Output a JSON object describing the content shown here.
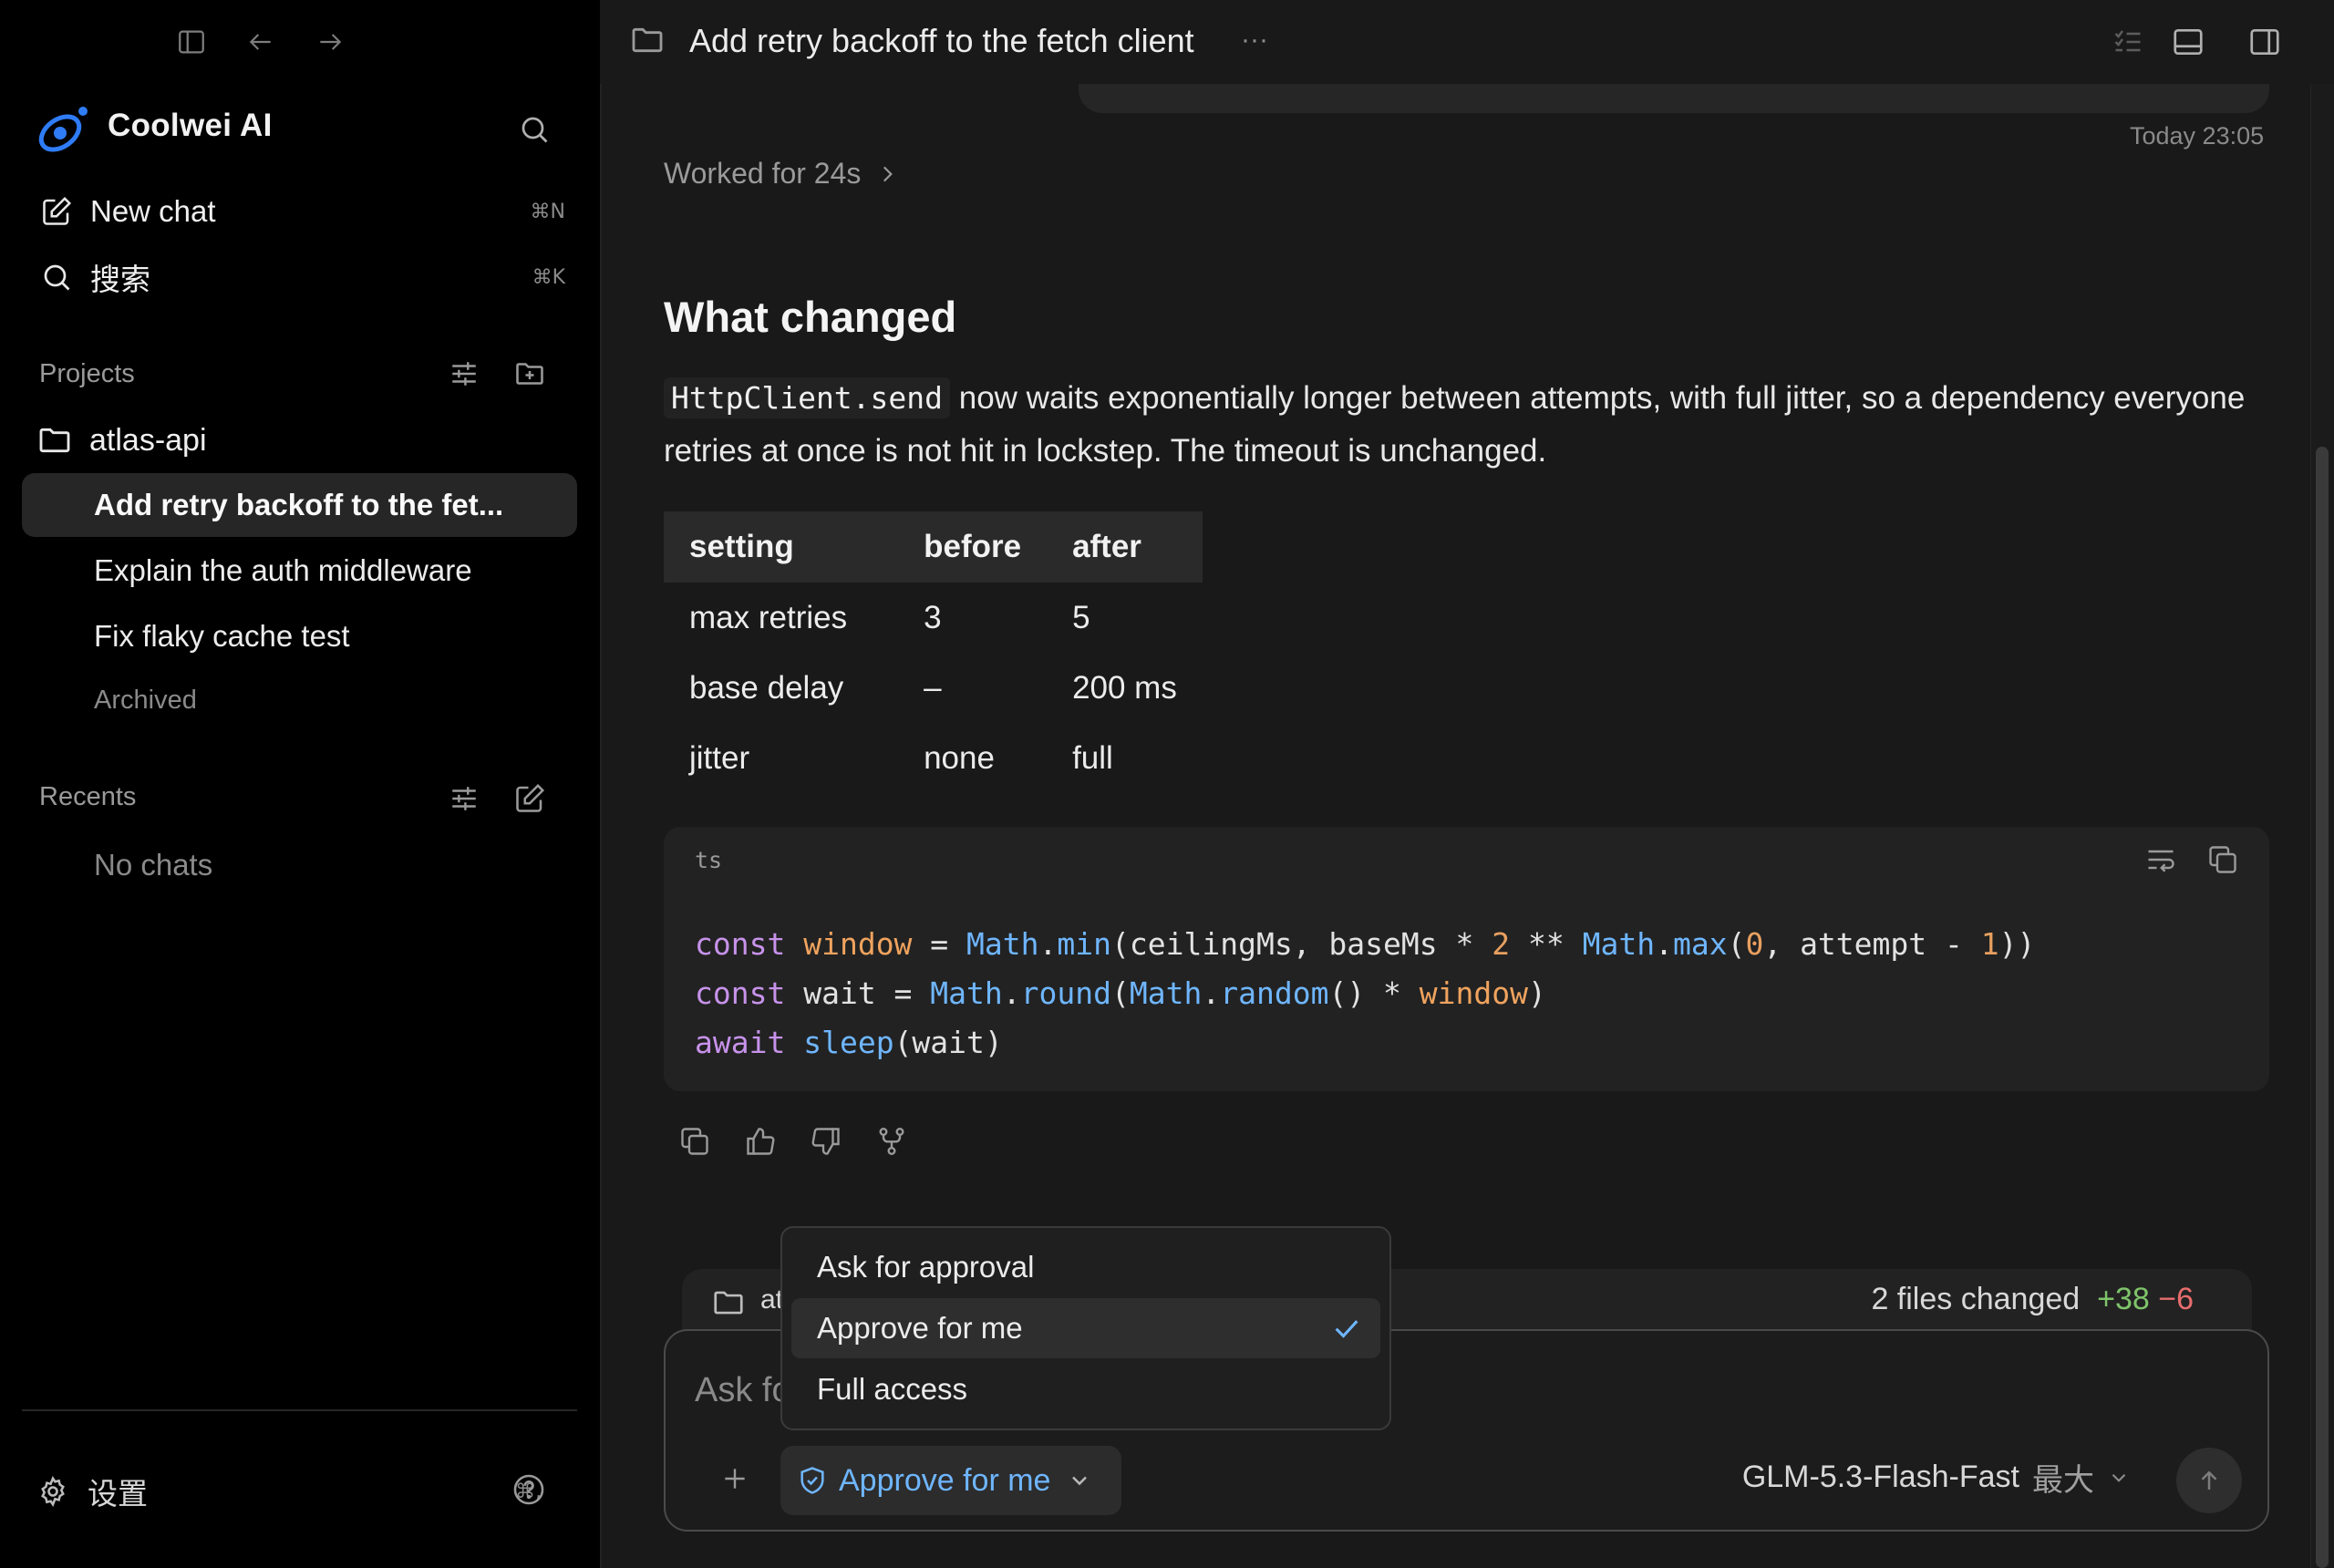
{
  "sidebar": {
    "brand_name": "Coolwei AI",
    "nav": {
      "new_chat": {
        "label": "New chat",
        "shortcut": "⌘N"
      },
      "search": {
        "label": "搜索",
        "shortcut": "⌘K"
      }
    },
    "projects": {
      "title": "Projects",
      "project_name": "atlas-api",
      "chats": [
        {
          "label": "Add retry backoff to the fet..."
        },
        {
          "label": "Explain the auth middleware"
        },
        {
          "label": "Fix flaky cache test"
        }
      ],
      "archived_label": "Archived"
    },
    "recents": {
      "title": "Recents",
      "empty_label": "No chats"
    },
    "settings": {
      "label": "设置",
      "shortcut": "⌘,"
    }
  },
  "topbar": {
    "title": "Add retry backoff to the fetch client",
    "more": "···"
  },
  "conversation": {
    "timestamp": "Today 23:05",
    "worked_label": "Worked for 24s",
    "heading": "What changed",
    "paragraph": {
      "code": "HttpClient.send",
      "text": " now waits exponentially longer between attempts, with full jitter, so a dependency everyone retries at once is not hit in lockstep. The timeout is unchanged."
    },
    "table": {
      "headers": [
        "setting",
        "before",
        "after"
      ],
      "rows": [
        [
          "max retries",
          "3",
          "5"
        ],
        [
          "base delay",
          "–",
          "200 ms"
        ],
        [
          "jitter",
          "none",
          "full"
        ]
      ]
    },
    "code_block": {
      "language": "ts",
      "lines": [
        [
          {
            "t": "const",
            "c": "kw"
          },
          {
            "t": " "
          },
          {
            "t": "window",
            "c": "var"
          },
          {
            "t": " = "
          },
          {
            "t": "Math",
            "c": "fn"
          },
          {
            "t": "."
          },
          {
            "t": "min",
            "c": "fn"
          },
          {
            "t": "(ceilingMs, baseMs * "
          },
          {
            "t": "2",
            "c": "num"
          },
          {
            "t": " ** "
          },
          {
            "t": "Math",
            "c": "fn"
          },
          {
            "t": "."
          },
          {
            "t": "max",
            "c": "fn"
          },
          {
            "t": "("
          },
          {
            "t": "0",
            "c": "num"
          },
          {
            "t": ", attempt - "
          },
          {
            "t": "1",
            "c": "num"
          },
          {
            "t": "))"
          }
        ],
        [
          {
            "t": "const",
            "c": "kw"
          },
          {
            "t": " wait = "
          },
          {
            "t": "Math",
            "c": "fn"
          },
          {
            "t": "."
          },
          {
            "t": "round",
            "c": "fn"
          },
          {
            "t": "("
          },
          {
            "t": "Math",
            "c": "fn"
          },
          {
            "t": "."
          },
          {
            "t": "random",
            "c": "fn"
          },
          {
            "t": "() * "
          },
          {
            "t": "window",
            "c": "var"
          },
          {
            "t": ")"
          }
        ],
        [
          {
            "t": "await",
            "c": "kw"
          },
          {
            "t": " "
          },
          {
            "t": "sleep",
            "c": "fn"
          },
          {
            "t": "(wait)"
          }
        ]
      ]
    }
  },
  "composer": {
    "project_label": "atlas-api",
    "files_changed": "2 files changed",
    "additions": "+38",
    "deletions": "−6",
    "placeholder": "Ask for follow-up changes",
    "approval_mode": "Approve for me",
    "model": "GLM-5.3-Flash-Fast",
    "effort": "最大"
  },
  "approval_dropdown": {
    "options": [
      {
        "label": "Ask for approval",
        "selected": false
      },
      {
        "label": "Approve for me",
        "selected": true
      },
      {
        "label": "Full access",
        "selected": false
      }
    ]
  },
  "colors": {
    "accent": "#6fb6ff",
    "additions": "#7ec46a",
    "deletions": "#e86d6d",
    "keyword": "#c792ea",
    "variable": "#f0a35e"
  },
  "icons": {
    "brand": "coolwei-logo-icon",
    "toggle_sidebar": "sidebar-toggle-icon",
    "back": "arrow-left-icon",
    "forward": "arrow-right-icon"
  }
}
